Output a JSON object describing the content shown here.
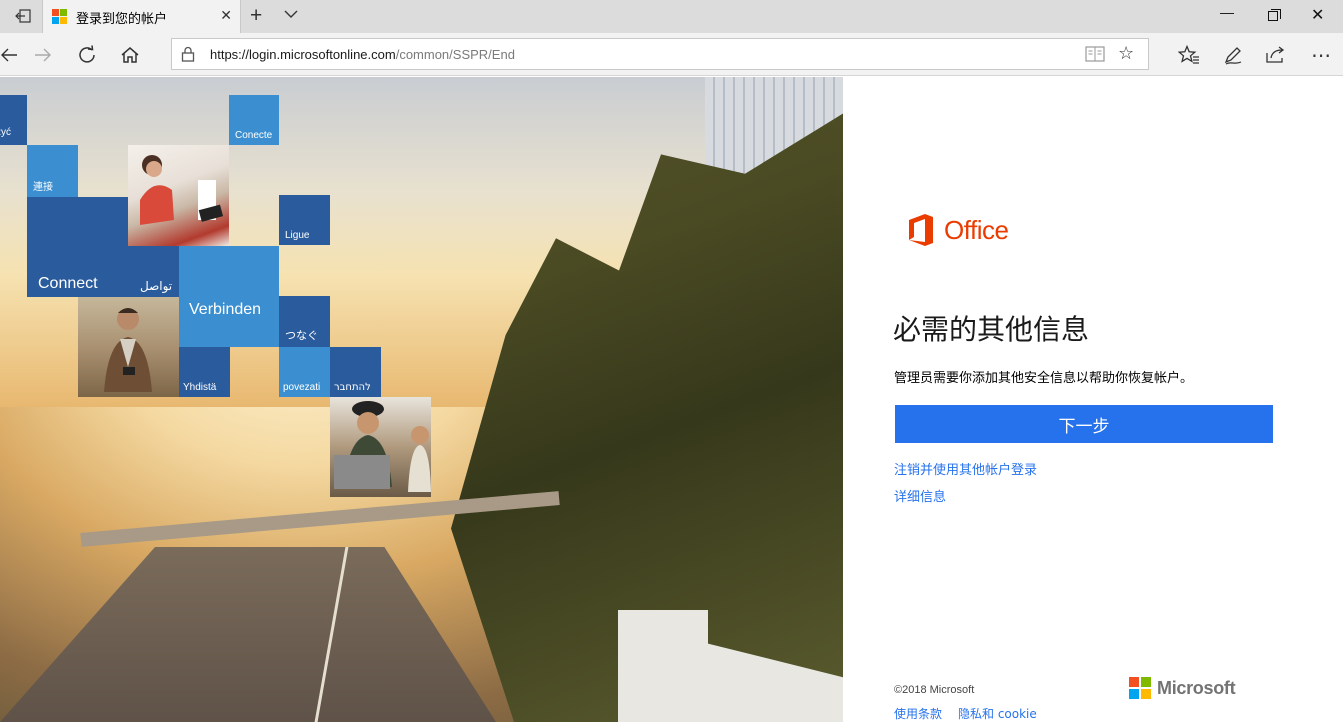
{
  "browser": {
    "tab_title": "登录到您的帐户",
    "url_host": "https://login.microsoftonline.com",
    "url_path": "/common/SSPR/End",
    "icons": {
      "set_tabs_aside": "set-tabs-aside-icon",
      "tab_close": "close-icon",
      "new_tab": "plus-icon",
      "tab_preview": "chevron-down-icon",
      "back": "back-arrow-icon",
      "forward": "forward-arrow-icon",
      "refresh": "refresh-icon",
      "home": "home-icon",
      "lock": "lock-icon",
      "reading_view": "reading-view-icon",
      "favorite": "star-icon",
      "favorites_hub": "favorites-hub-icon",
      "notes": "pen-icon",
      "share": "share-icon",
      "more": "more-icon"
    },
    "tab_close_glyph": "✕",
    "new_tab_glyph": "+",
    "window_minimize_glyph": "—",
    "window_close_glyph": "✕",
    "favorite_glyph": "☆",
    "more_glyph": "⋯"
  },
  "hero": {
    "tiles": {
      "polish": "żyć",
      "conecte": "Conecte",
      "chinese": "連接",
      "ligue": "Ligue",
      "connect": "Connect",
      "arabic": "تواصل",
      "verbinden": "Verbinden",
      "japanese": "つなぐ",
      "finnish": "Yhdistä",
      "portuguese": "povezati",
      "hebrew": "להתחבר"
    }
  },
  "panel": {
    "brand": "Office",
    "heading": "必需的其他信息",
    "description": "管理员需要你添加其他安全信息以帮助你恢复帐户。",
    "next_button": "下一步",
    "link_switch_account": "注销并使用其他帐户登录",
    "link_more_info": "详细信息",
    "copyright": "©2018 Microsoft",
    "terms": "使用条款",
    "privacy": "隐私和 cookie",
    "microsoft_word": "Microsoft"
  },
  "colors": {
    "accent": "#2672ec",
    "office_orange": "#eb3c00",
    "ms_red": "#f25022",
    "ms_green": "#7fba00",
    "ms_blue": "#00a4ef",
    "ms_yellow": "#ffb900",
    "tile_dark": "#2a5b9c",
    "tile_light": "#3b8fd0"
  }
}
